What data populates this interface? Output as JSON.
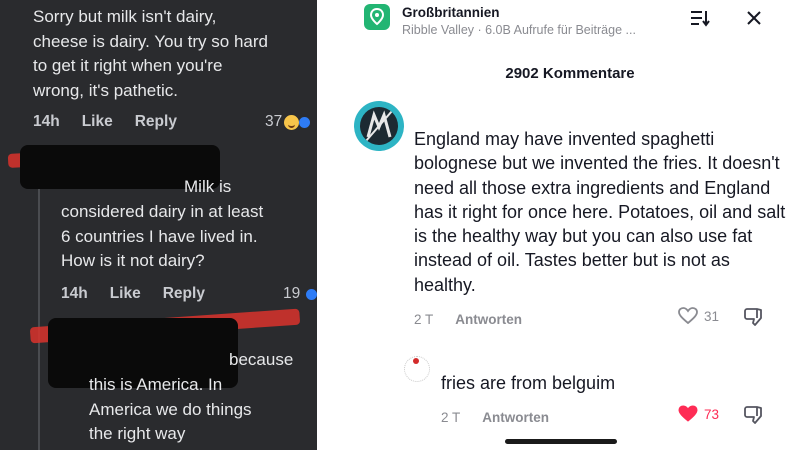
{
  "facebook": {
    "comments": [
      {
        "text": "Sorry but milk isn't dairy,\ncheese is dairy. You try so hard\nto get it right when you're\nwrong, it's pathetic.",
        "time": "14h",
        "like": "Like",
        "reply": "Reply",
        "count": "37"
      },
      {
        "text": "considered dairy in at least\n6 countries I have lived in.\nHow is it not dairy?",
        "text_lead": "Milk is",
        "time": "14h",
        "like": "Like",
        "reply": "Reply",
        "count": "19"
      },
      {
        "text_lead": "because",
        "text": "this is America. In\nAmerica we do things\nthe right way"
      }
    ],
    "colors": {
      "background": "#2a2b2e",
      "redaction": "#0a0a0a",
      "redaction_accent": "#d9332b",
      "reaction_like": "#2e7cf6"
    }
  },
  "sheet": {
    "header": {
      "icon": "location-pin-icon",
      "title": "Großbritannien",
      "subtitle": "Ribble Valley · 6.0B Aufrufe für Beiträge ...",
      "filter_icon": "sort-list-icon",
      "close_icon": "close-icon"
    },
    "comment_count": "2902 Kommentare",
    "comments": [
      {
        "text": "England may have invented spaghetti bolognese but we invented the fries. It doesn't need all those extra ingredients and England has it right for once here. Potatoes, oil and salt is the healthy way but you can also use fat instead of oil. Tastes better but is not as healthy.",
        "age": "2 T",
        "reply": "Antworten",
        "likes": "31",
        "liked": false
      },
      {
        "text": "fries are from belguim",
        "age": "2 T",
        "reply": "Antworten",
        "likes": "73",
        "liked": true
      }
    ],
    "colors": {
      "accent_like": "#fe2c55",
      "location_icon": "#22b573",
      "muted": "#8a8b91",
      "avatar_ring": "#2db4c4"
    }
  }
}
